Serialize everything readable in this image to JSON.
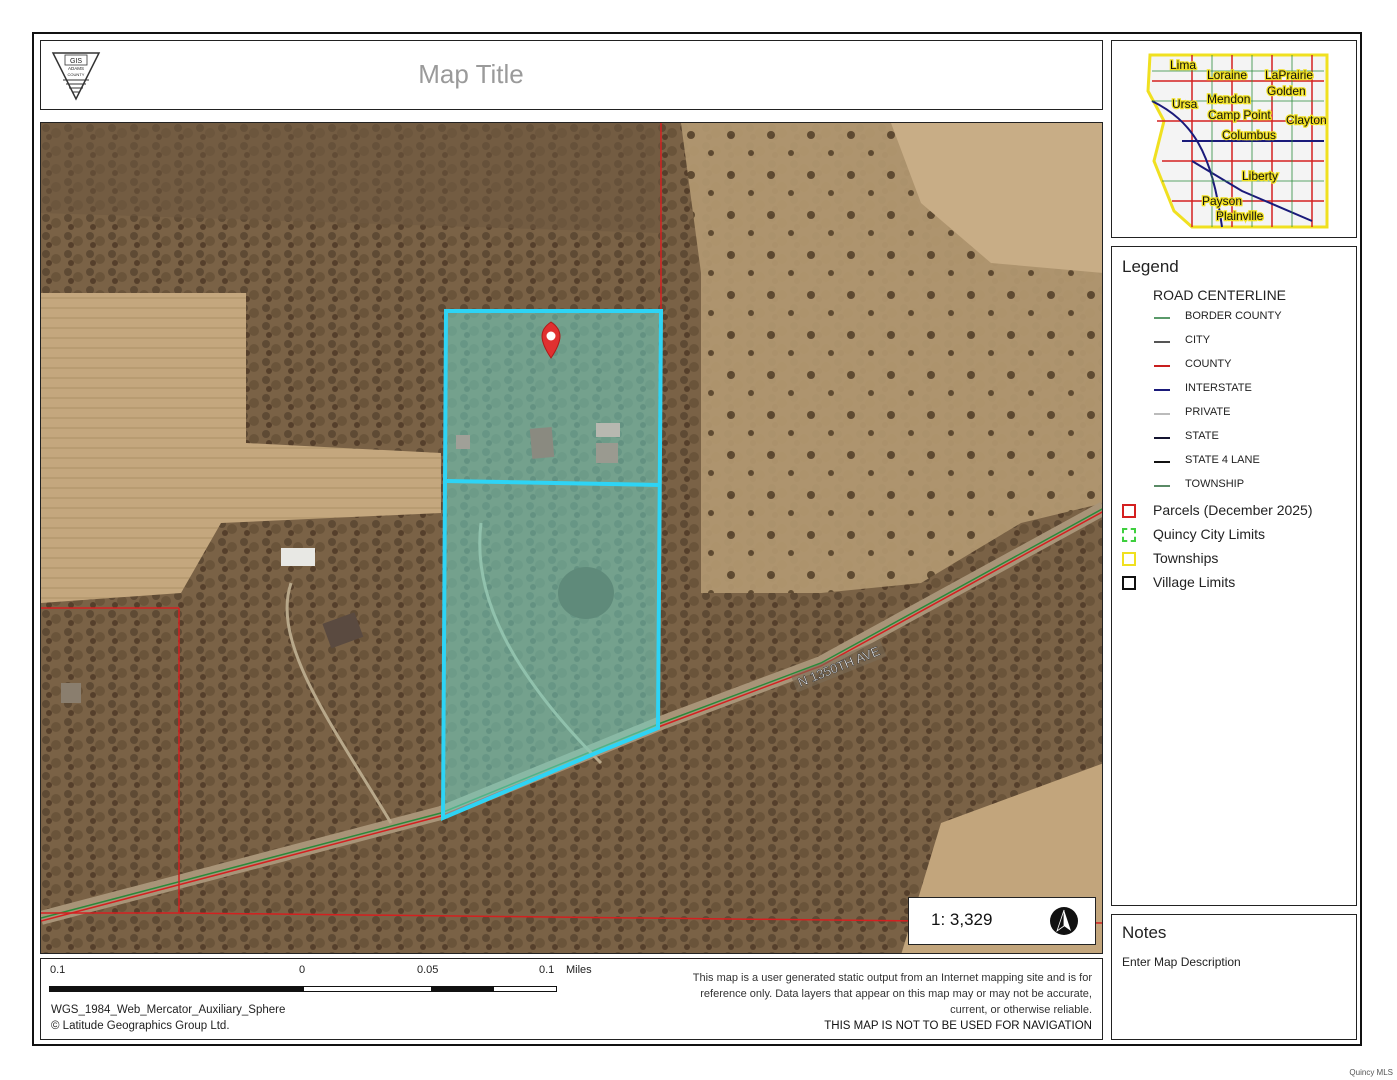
{
  "header": {
    "title": "Map Title",
    "logo_text": [
      "GIS",
      "ADAMS",
      "COUNTY"
    ]
  },
  "map": {
    "road_label": "N 1350TH AVE",
    "scale_ratio": "1: 3,329",
    "colors": {
      "parcel_outline": "#d42020",
      "selection": "#2ed4f5",
      "selection_fill": "#6fd6c8"
    }
  },
  "inset": {
    "place_names": [
      "Lima",
      "Loraine",
      "LaPrairie",
      "Golden",
      "Ursa",
      "Mendon",
      "Camp Point",
      "Clayton",
      "Columbus",
      "Liberty",
      "Payson",
      "Plainville"
    ]
  },
  "legend": {
    "title": "Legend",
    "group_title": "ROAD CENTERLINE",
    "road_items": [
      {
        "label": "BORDER COUNTY",
        "color": "#5a9a6a"
      },
      {
        "label": "CITY",
        "color": "#555555"
      },
      {
        "label": "COUNTY",
        "color": "#c81e1e"
      },
      {
        "label": "INTERSTATE",
        "color": "#1a1a7a"
      },
      {
        "label": "PRIVATE",
        "color": "#bbbbbb"
      },
      {
        "label": "STATE",
        "color": "#141430"
      },
      {
        "label": "STATE 4 LANE",
        "color": "#111111"
      },
      {
        "label": "TOWNSHIP",
        "color": "#5a8a66"
      }
    ],
    "layers": [
      {
        "label": "Parcels (December 2025)",
        "color": "#d42020",
        "style": "solid"
      },
      {
        "label": "Quincy City Limits",
        "color": "#3ecf3e",
        "style": "dashed"
      },
      {
        "label": "Townships",
        "color": "#f0e020",
        "style": "solid"
      },
      {
        "label": "Village Limits",
        "color": "#111111",
        "style": "solid"
      }
    ]
  },
  "notes": {
    "title": "Notes",
    "text": "Enter Map Description"
  },
  "footer": {
    "scale_labels": [
      "0.1",
      "0",
      "0.05",
      "0.1",
      "Miles"
    ],
    "projection": "WGS_1984_Web_Mercator_Auxiliary_Sphere",
    "copyright": "© Latitude Geographics Group Ltd.",
    "disclaimer_lines": [
      "This map is a user generated static output from an Internet mapping site and is for",
      "reference only. Data layers that appear on this map may or may not be accurate,",
      "current, or otherwise reliable."
    ],
    "navigation_warning": "THIS MAP IS NOT TO BE USED FOR NAVIGATION"
  },
  "watermark": "Quincy MLS"
}
